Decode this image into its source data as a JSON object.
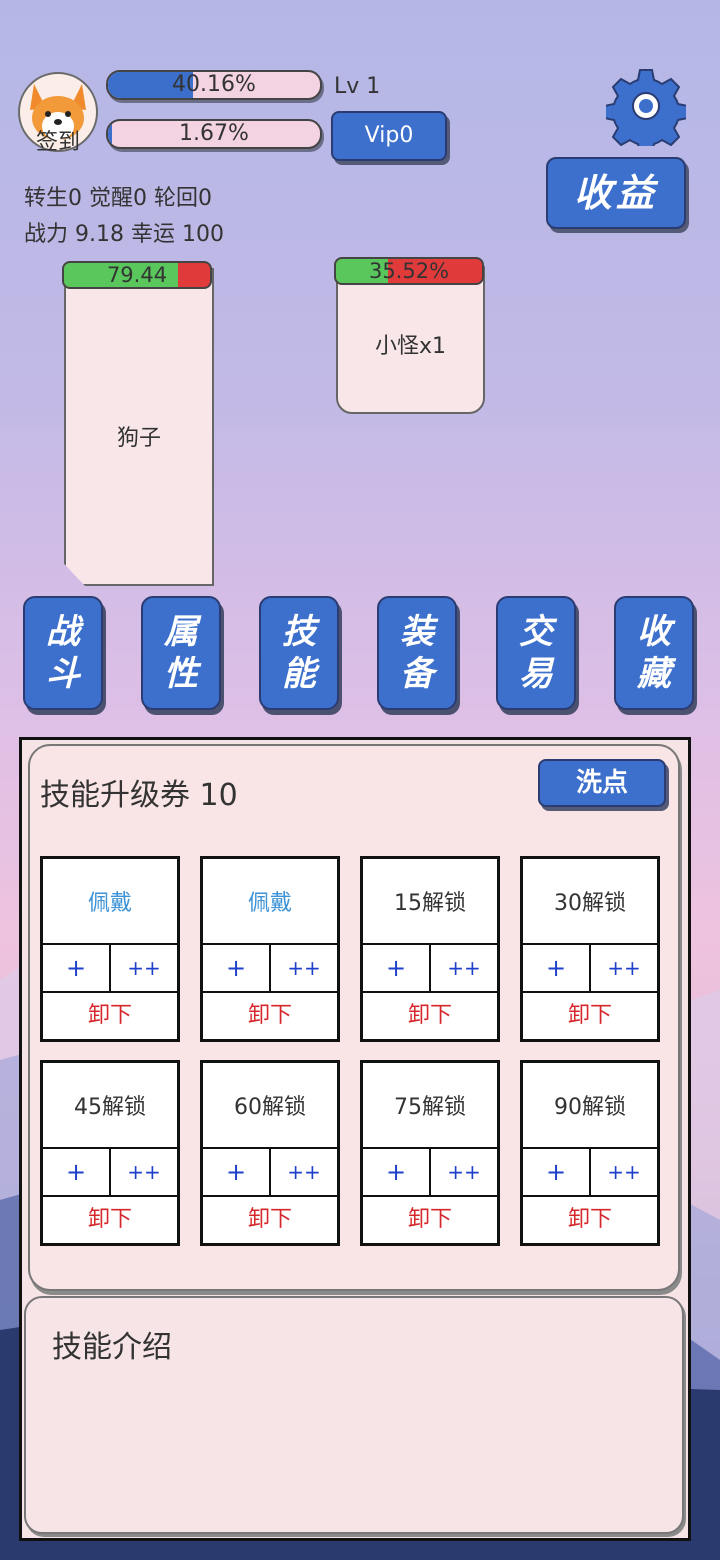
{
  "player": {
    "checkin_label": "签到",
    "exp_percent_text": "40.16%",
    "exp_fraction": 0.4016,
    "level_text": "Lv 1",
    "vip_progress_text": "1.67%",
    "vip_fraction": 0.0167,
    "vip_label": "Vip0",
    "rebirth_line": "转生0 觉醒0 轮回0",
    "power_line": "战力 9.18  幸运 100"
  },
  "top_right": {
    "settings_icon": "gear-icon",
    "income_label": "收益"
  },
  "battle": {
    "hero": {
      "name": "狗子",
      "hp_text": "79.44",
      "hp_fraction": 0.78
    },
    "enemy": {
      "name": "小怪x1",
      "hp_text": "35.52%",
      "hp_fraction": 0.3552
    }
  },
  "menu": [
    {
      "line1": "战",
      "line2": "斗"
    },
    {
      "line1": "属",
      "line2": "性"
    },
    {
      "line1": "技",
      "line2": "能"
    },
    {
      "line1": "装",
      "line2": "备"
    },
    {
      "line1": "交",
      "line2": "易"
    },
    {
      "line1": "收",
      "line2": "藏"
    }
  ],
  "skills": {
    "ticket_text": "技能升级券 10",
    "wash_label": "洗点",
    "slots": [
      {
        "title": "佩戴",
        "worn": true,
        "plus": "+",
        "pplus": "++",
        "unequip": "卸下"
      },
      {
        "title": "佩戴",
        "worn": true,
        "plus": "+",
        "pplus": "++",
        "unequip": "卸下"
      },
      {
        "title": "15解锁",
        "worn": false,
        "plus": "+",
        "pplus": "++",
        "unequip": "卸下"
      },
      {
        "title": "30解锁",
        "worn": false,
        "plus": "+",
        "pplus": "++",
        "unequip": "卸下"
      },
      {
        "title": "45解锁",
        "worn": false,
        "plus": "+",
        "pplus": "++",
        "unequip": "卸下"
      },
      {
        "title": "60解锁",
        "worn": false,
        "plus": "+",
        "pplus": "++",
        "unequip": "卸下"
      },
      {
        "title": "75解锁",
        "worn": false,
        "plus": "+",
        "pplus": "++",
        "unequip": "卸下"
      },
      {
        "title": "90解锁",
        "worn": false,
        "plus": "+",
        "pplus": "++",
        "unequip": "卸下"
      }
    ],
    "intro_label": "技能介绍"
  },
  "colors": {
    "button_blue": "#3d6fcc",
    "hp_green": "#59c75c",
    "hp_red": "#e03a3a",
    "worn_text": "#3d93d6",
    "unequip_text": "#d6282c"
  }
}
